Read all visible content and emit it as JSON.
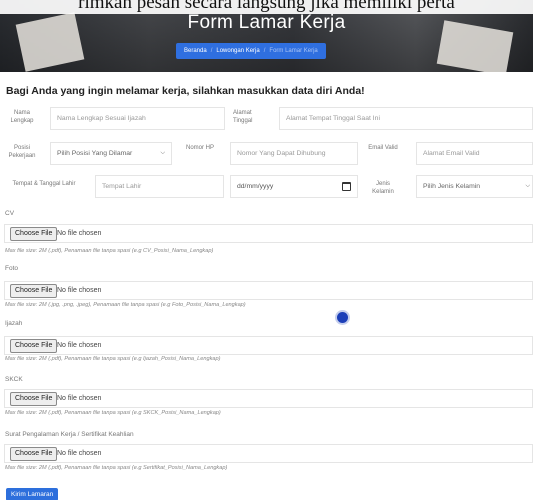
{
  "hero": {
    "overlay_text": "rimkan pesan secara langsung jika memiliki perta",
    "title": "Form Lamar Kerja",
    "breadcrumb": [
      "Beranda",
      "Lowongan Kerja",
      "Form Lamar Kerja"
    ]
  },
  "heading": "Bagi Anda yang ingin melamar kerja, silahkan masukkan data diri Anda!",
  "fields": {
    "nama": {
      "label": "Nama Lengkap",
      "placeholder": "Nama Lengkap Sesuai Ijazah"
    },
    "alamat": {
      "label": "Alamat Tinggal",
      "placeholder": "Alamat Tempat Tinggal Saat Ini"
    },
    "posisi": {
      "label": "Posisi Pekerjaan",
      "value": "Pilih Posisi Yang Dilamar"
    },
    "hp": {
      "label": "Nomor HP",
      "placeholder": "Nomor Yang Dapat Dihubung"
    },
    "email": {
      "label": "Email Valid",
      "placeholder": "Alamat Email Valid"
    },
    "ttl": {
      "label": "Tempat & Tanggal Lahir",
      "placeholder": "Tempat Lahir",
      "date_placeholder": "dd/mm/yyyy"
    },
    "jk": {
      "label": "Jenis Kelamin",
      "value": "Pilih Jenis Kelamin"
    }
  },
  "uploads": [
    {
      "label": "CV",
      "button": "Choose File",
      "status": "No file chosen",
      "hint": "Max file size: 2M (.pdf), Penamaan file tanpa spasi (e.g CV_Posisi_Nama_Lengkap)"
    },
    {
      "label": "Foto",
      "button": "Choose File",
      "status": "No file chosen",
      "hint": "Max file size: 2M (.jpg, .png, .jpeg), Penamaan file tanpa spasi (e.g Foto_Posisi_Nama_Lengkap)"
    },
    {
      "label": "Ijazah",
      "button": "Choose File",
      "status": "No file chosen",
      "hint": "Max file size: 2M (.pdf), Penamaan file tanpa spasi (e.g Ijazah_Posisi_Nama_Lengkap)"
    },
    {
      "label": "SKCK",
      "button": "Choose File",
      "status": "No file chosen",
      "hint": "Max file size: 2M (.pdf), Penamaan file tanpa spasi (e.g SKCK_Posisi_Nama_Lengkap)"
    },
    {
      "label": "Surat Pengalaman Kerja / Sertifikat Keahlian",
      "button": "Choose File",
      "status": "No file chosen",
      "hint": "Max file size: 2M (.pdf), Penamaan file tanpa spasi (e.g Sertifikat_Posisi_Nama_Lengkap)"
    }
  ],
  "submit_label": "Kirim Lamaran",
  "icons": {
    "calendar": "calendar-icon",
    "select": "chevron-down-icon"
  },
  "colors": {
    "accent": "#2d6fdc",
    "cursor": "#1c3fb8"
  }
}
